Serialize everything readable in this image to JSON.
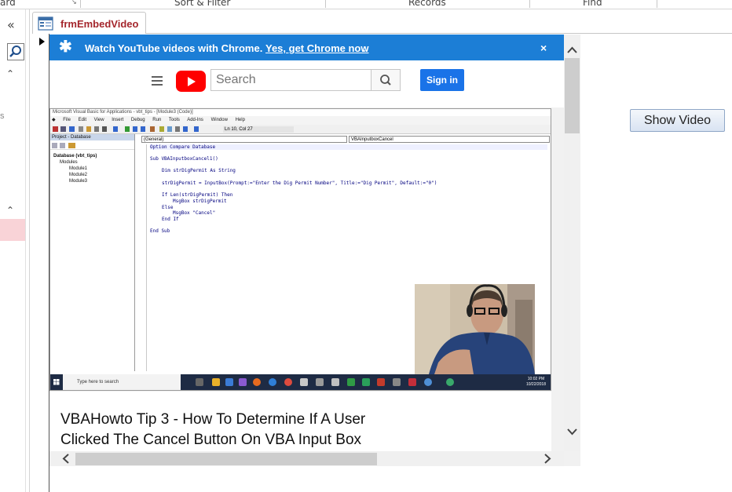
{
  "ribbon": {
    "groups": [
      "ard",
      "Sort & Filter",
      "Records",
      "Find"
    ]
  },
  "nav_pane": {
    "truncated_text": "s"
  },
  "document_tab": {
    "label": "frmEmbedVideo"
  },
  "chrome_banner": {
    "message": "Watch YouTube videos with Chrome.",
    "link": "Yes, get Chrome now",
    "link_suffix": ".",
    "close_glyph": "×",
    "bg_color": "#1c7ed6"
  },
  "youtube": {
    "search_placeholder": "Search",
    "sign_in": "Sign in",
    "logo_color": "#ff0000"
  },
  "vba_window": {
    "title": "Microsoft Visual Basic for Applications - vbt_tips - [Module3 (Code)]",
    "menu": [
      "File",
      "Edit",
      "View",
      "Insert",
      "Debug",
      "Run",
      "Tools",
      "Add-Ins",
      "Window",
      "Help"
    ],
    "cursor_position": "Ln 10, Col 27",
    "project_title": "Project - Database",
    "project_tree": [
      "Database (vbt_tips)",
      "Modules",
      "Module1",
      "Module2",
      "Module3"
    ],
    "combo_general": "(General)",
    "combo_proc": "VBAInputboxCancel",
    "code_lines": [
      "Option Compare Database",
      "Sub VBAInputboxCancel1()",
      "Dim strDigPermit As String",
      "strDigPermit = InputBox(Prompt:=\"Enter the Dig Permit Number\", Title:=\"Dig Permit\", Default:=\"0\")",
      "If Len(strDigPermit) Then",
      "MsgBox strDigPermit",
      "Else",
      "MsgBox \"Cancel\"",
      "End If",
      "End Sub"
    ],
    "taskbar_search": "Type here to search",
    "taskbar_time": "10:02 PM",
    "taskbar_date": "10/22/2018"
  },
  "video": {
    "title_line1": "VBAHowto Tip 3 - How To Determine If A User",
    "title_line2": "Clicked The Cancel Button On VBA Input Box"
  },
  "form": {
    "show_video_label": "Show Video"
  }
}
